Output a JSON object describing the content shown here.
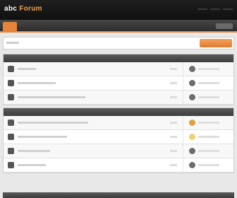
{
  "header": {
    "logo_main": "abc",
    "logo_accent": "Forum"
  },
  "theme": {
    "header_bg": "#141414",
    "accent": "#e8843a",
    "category_bar": "#4a4a4a",
    "page_bg": "#e8e8e8"
  },
  "toolbar": {
    "action_icon": "new-topic-button"
  },
  "categories": [
    {
      "forums": [
        {
          "icon": "forum-icon",
          "avatar_color": "#6d6d6d"
        },
        {
          "icon": "forum-icon",
          "avatar_color": "#6d6d6d"
        },
        {
          "icon": "forum-icon",
          "avatar_color": "#6d6d6d"
        }
      ]
    },
    {
      "forums": [
        {
          "icon": "forum-icon",
          "avatar_color": "#e0a040"
        },
        {
          "icon": "forum-icon",
          "avatar_color": "#f2d070"
        },
        {
          "icon": "forum-icon",
          "avatar_color": "#6d6d6d"
        },
        {
          "icon": "forum-icon",
          "avatar_color": "#6d6d6d"
        }
      ]
    }
  ]
}
